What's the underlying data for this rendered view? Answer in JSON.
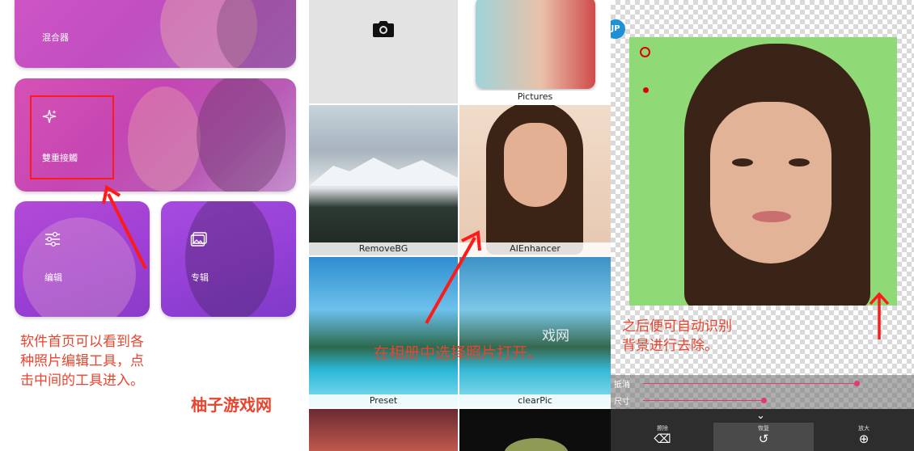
{
  "panel1": {
    "cards": {
      "blend": "混合器",
      "dual_exposure": "雙重接觸",
      "edit": "编辑",
      "album": "专辑"
    },
    "note_lines": [
      "软件首页可以看到各",
      "种照片编辑工具，点",
      "击中间的工具进入。"
    ],
    "brand": "柚子游戏网"
  },
  "panel2": {
    "tiles": [
      "Pictures",
      "RemoveBG",
      "AIEnhancer",
      "Preset",
      "clearPic"
    ],
    "note": "在相册中选择照片打开。",
    "watermark": "戏网"
  },
  "panel3": {
    "note_lines": [
      "之后便可自动识别",
      "背景进行去除。"
    ],
    "sliders": [
      {
        "label": "抵消",
        "value": 0.8
      },
      {
        "label": "尺寸",
        "value": 0.45
      }
    ],
    "tools": [
      {
        "label": "擦除",
        "icon": "eraser-icon",
        "glyph": "⌫"
      },
      {
        "label": "恢复",
        "icon": "restore-icon",
        "glyph": "↺"
      },
      {
        "label": "放大",
        "icon": "zoom-in-icon",
        "glyph": "⊕"
      }
    ],
    "colors": {
      "accent": "#e23a6a",
      "note": "#e8442e",
      "green_bg": "#8fda76"
    }
  }
}
